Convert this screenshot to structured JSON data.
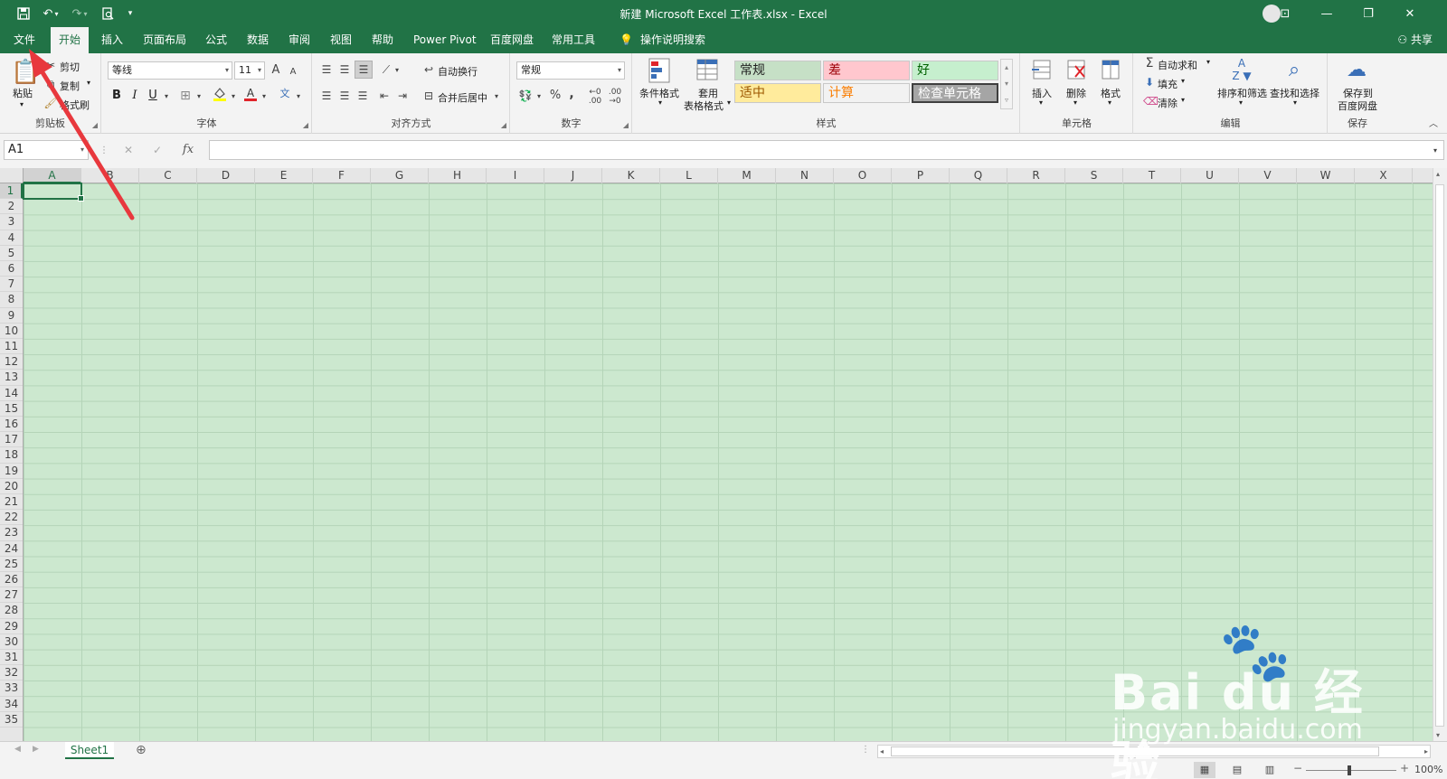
{
  "titlebar": {
    "title": "新建 Microsoft Excel 工作表.xlsx  -  Excel",
    "qat": [
      "save-icon",
      "undo-icon",
      "redo-icon",
      "print-preview-icon",
      "customize-icon"
    ],
    "min": "—",
    "restore": "❐",
    "close": "✕",
    "ribbon_opts": "⊡"
  },
  "tabs": [
    {
      "label": "文件"
    },
    {
      "label": "开始"
    },
    {
      "label": "插入"
    },
    {
      "label": "页面布局"
    },
    {
      "label": "公式"
    },
    {
      "label": "数据"
    },
    {
      "label": "审阅"
    },
    {
      "label": "视图"
    },
    {
      "label": "帮助"
    },
    {
      "label": "Power Pivot"
    },
    {
      "label": "百度网盘"
    },
    {
      "label": "常用工具"
    },
    {
      "label": "操作说明搜索"
    }
  ],
  "share": "共享",
  "clipboard": {
    "paste": "粘贴",
    "cut": "剪切",
    "copy": "复制",
    "painter": "格式刷",
    "label": "剪贴板"
  },
  "font": {
    "name": "等线",
    "size": "11",
    "bold": "B",
    "italic": "I",
    "underline": "U",
    "label": "字体",
    "grow": "A",
    "shrink": "A"
  },
  "align": {
    "wrap": "自动换行",
    "merge": "合并后居中",
    "label": "对齐方式"
  },
  "number": {
    "format": "常规",
    "percent": "%",
    "comma": ",",
    "label": "数字"
  },
  "styles": {
    "cond": "条件格式",
    "table1": "套用",
    "table2": "表格格式",
    "cells": [
      {
        "text": "常规",
        "bg": "#c6e0c6",
        "fg": "#222222"
      },
      {
        "text": "差",
        "bg": "#ffc7ce",
        "fg": "#9c0006"
      },
      {
        "text": "好",
        "bg": "#c6efce",
        "fg": "#006100"
      },
      {
        "text": "适中",
        "bg": "#ffeb9c",
        "fg": "#9c5700"
      },
      {
        "text": "计算",
        "bg": "#f2f2f2",
        "fg": "#fa7d00"
      },
      {
        "text": "检查单元格",
        "bg": "#a5a5a5",
        "fg": "#ffffff"
      }
    ],
    "label": "样式"
  },
  "cellsgrp": {
    "insert": "插入",
    "delete": "删除",
    "format": "格式",
    "label": "单元格"
  },
  "editing": {
    "autosum": "自动求和",
    "fill": "填充",
    "clear": "清除",
    "sort": "排序和筛选",
    "find": "查找和选择",
    "label": "编辑"
  },
  "save": {
    "line1": "保存到",
    "line2": "百度网盘",
    "label": "保存"
  },
  "formula": {
    "namebox": "A1",
    "fx": "fx",
    "cancel": "✕",
    "enter": "✓"
  },
  "columns": [
    "A",
    "B",
    "C",
    "D",
    "E",
    "F",
    "G",
    "H",
    "I",
    "J",
    "K",
    "L",
    "M",
    "N",
    "O",
    "P",
    "Q",
    "R",
    "S",
    "T",
    "U",
    "V",
    "W",
    "X"
  ],
  "rows": [
    "1",
    "2",
    "3",
    "4",
    "5",
    "6",
    "7",
    "8",
    "9",
    "10",
    "11",
    "12",
    "13",
    "14",
    "15",
    "16",
    "17",
    "18",
    "19",
    "20",
    "21",
    "22",
    "23",
    "24",
    "25",
    "26",
    "27",
    "28",
    "29",
    "30",
    "31",
    "32",
    "33",
    "34",
    "35"
  ],
  "sheet": {
    "name": "Sheet1",
    "add": "⊕"
  },
  "status": {
    "zoom": "100%"
  },
  "watermark": {
    "brand": "Bai du 经验",
    "url": "jingyan.baidu.com"
  }
}
